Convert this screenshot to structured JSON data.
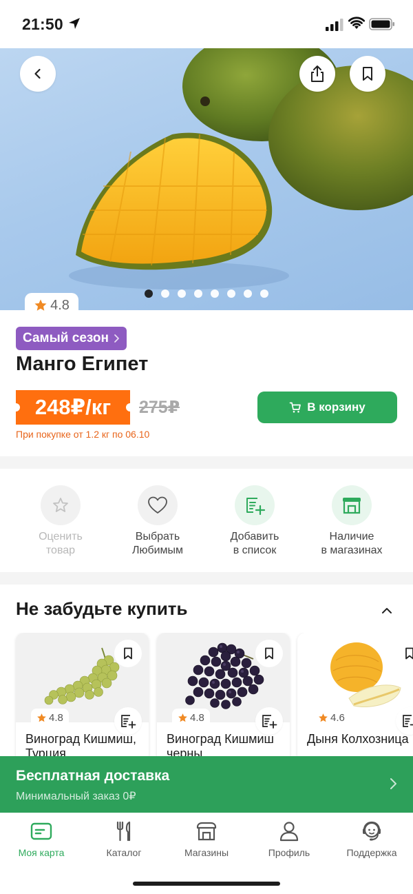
{
  "status_bar": {
    "time": "21:50"
  },
  "product": {
    "rating": "4.8",
    "badge": "Самый сезон",
    "title": "Манго Египет",
    "price": "248₽/кг",
    "old_price": "275₽",
    "promo_note": "При покупке от 1.2 кг по 06.10",
    "cart_button": "В корзину",
    "gallery_dots": 8,
    "gallery_active_index": 0
  },
  "actions": [
    {
      "label": "Оценить\nтовар",
      "icon": "star-outline-icon",
      "enabled": false
    },
    {
      "label": "Выбрать\nЛюбимым",
      "icon": "heart-outline-icon",
      "enabled": true
    },
    {
      "label": "Добавить\nв список",
      "icon": "add-to-list-icon",
      "enabled": true
    },
    {
      "label": "Наличие\nв магазинах",
      "icon": "store-icon",
      "enabled": true
    }
  ],
  "section": {
    "title": "Не забудьте купить"
  },
  "cards": [
    {
      "rating": "4.8",
      "name": "Виноград Кишмиш, Турция"
    },
    {
      "rating": "4.8",
      "name": "Виноград Кишмиш черны..."
    },
    {
      "rating": "4.6",
      "name": "Дыня Колхозница"
    }
  ],
  "delivery": {
    "title": "Бесплатная доставка",
    "min_label": "Минимальный заказ",
    "min_value": "0₽"
  },
  "tabs": [
    {
      "label": "Моя карта",
      "icon": "card-icon",
      "active": true
    },
    {
      "label": "Каталог",
      "icon": "catalog-icon",
      "active": false
    },
    {
      "label": "Магазины",
      "icon": "store-icon",
      "active": false
    },
    {
      "label": "Профиль",
      "icon": "profile-icon",
      "active": false
    },
    {
      "label": "Поддержка",
      "icon": "support-icon",
      "active": false
    }
  ],
  "colors": {
    "accent_green": "#2eaa5c",
    "price_orange": "#ff6f0f",
    "badge_purple": "#8e5bc1",
    "delivery_green": "#2da05a"
  }
}
